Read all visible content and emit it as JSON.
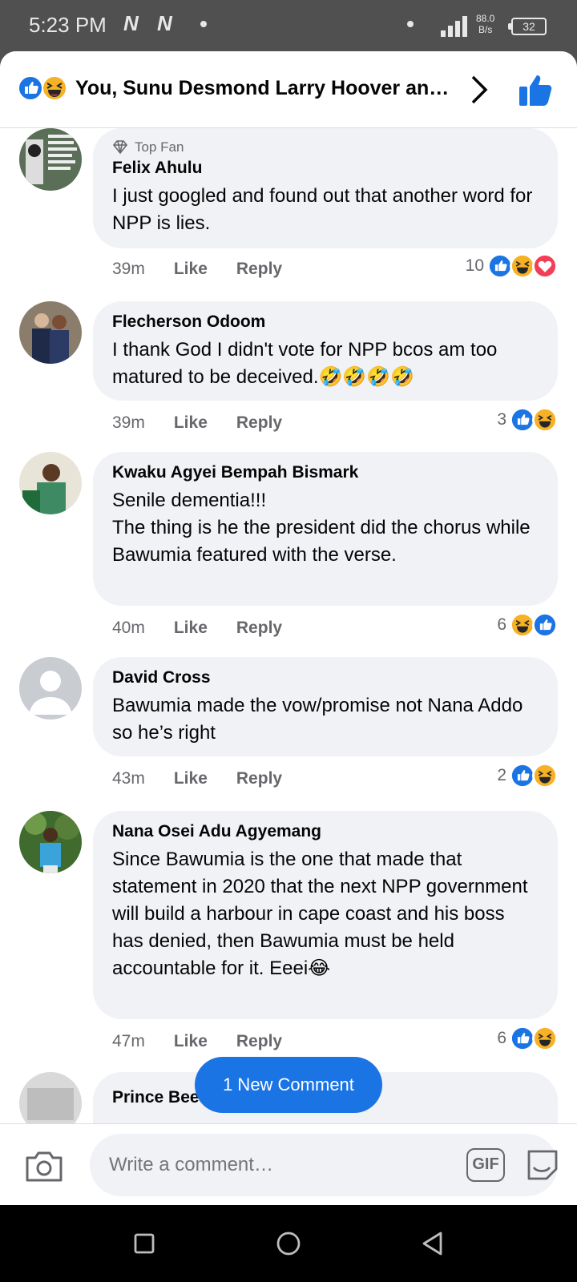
{
  "status_bar": {
    "time": "5:23 PM",
    "net_icon": "N",
    "speed": "88.0",
    "speed_unit": "B/s",
    "battery": "32"
  },
  "header": {
    "title": "You, Sunu Desmond Larry Hoover and others",
    "reaction_icons": [
      "like-icon",
      "haha-icon"
    ]
  },
  "comments": [
    {
      "top_fan": "Top Fan",
      "author": "Felix Ahulu",
      "text": "I just googled and found out that another word for NPP is lies.",
      "time": "39m",
      "like": "Like",
      "reply": "Reply",
      "reaction_count": "10",
      "reactions": [
        "like",
        "haha",
        "love"
      ]
    },
    {
      "author": "Flecherson Odoom",
      "text": "I thank God I didn't vote for NPP bcos am too matured to be deceived.🤣🤣🤣🤣",
      "time": "39m",
      "like": "Like",
      "reply": "Reply",
      "reaction_count": "3",
      "reactions": [
        "like",
        "haha"
      ]
    },
    {
      "author": "Kwaku Agyei Bempah Bismark",
      "text": "Senile dementia!!!\nThe thing is he the president did the chorus while Bawumia featured with the verse.",
      "time": "40m",
      "like": "Like",
      "reply": "Reply",
      "reaction_count": "6",
      "reactions": [
        "haha",
        "like"
      ]
    },
    {
      "author": "David Cross",
      "text": "Bawumia made the vow/promise not Nana Addo so he’s right",
      "time": "43m",
      "like": "Like",
      "reply": "Reply",
      "reaction_count": "2",
      "reactions": [
        "like",
        "haha"
      ]
    },
    {
      "author": "Nana Osei Adu Agyemang",
      "text": "Since Bawumia is the one that made that statement in 2020 that the next NPP government will build a harbour in cape coast and his boss has denied, then Bawumia must be held accountable for it. Eeei😂",
      "time": "47m",
      "like": "Like",
      "reply": "Reply",
      "reaction_count": "6",
      "reactions": [
        "like",
        "haha"
      ]
    },
    {
      "author": "Prince Bee"
    }
  ],
  "new_comment_button": "1 New Comment",
  "composer": {
    "placeholder": "Write a comment…",
    "gif_label": "GIF"
  },
  "colors": {
    "accent": "#1b74e4",
    "bubble": "#f0f2f5",
    "love": "#f33e58",
    "haha": "#f7b125"
  }
}
